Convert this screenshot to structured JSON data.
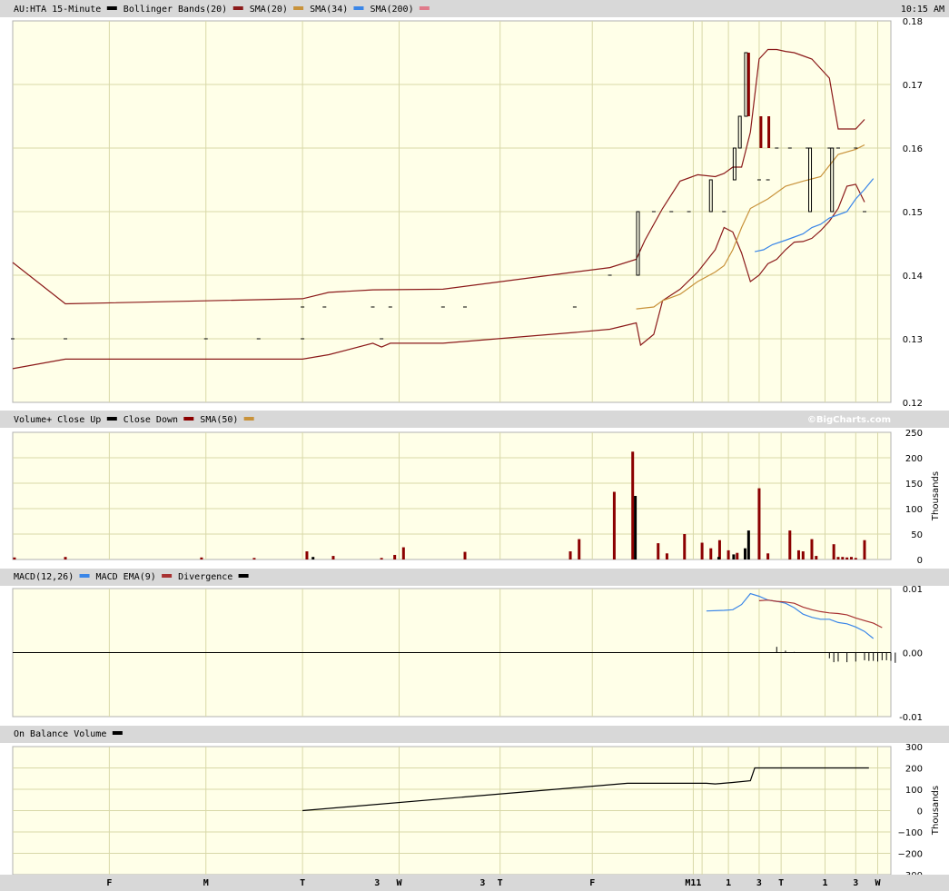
{
  "header": {
    "symbol": "AU:HTA 15-Minute",
    "time": "10:15 AM",
    "brand": "©BigCharts.com"
  },
  "colors": {
    "price": "#000000",
    "bb": "#8b1a1a",
    "sma20": "#c8923a",
    "sma34": "#3a86e8",
    "sma200": "#e07a8a",
    "volUp": "#000000",
    "volDown": "#8b0000",
    "macd": "#3a86e8",
    "macdEma": "#a83232",
    "obv": "#000000",
    "panelBg": "#ffffe8",
    "grid": "#d8d8a8",
    "band": "#d8d8d8"
  },
  "legends": {
    "price": [
      {
        "label": "Bollinger Bands(20)",
        "swatch": "bb"
      },
      {
        "label": "SMA(20)",
        "swatch": "sma20"
      },
      {
        "label": "SMA(34)",
        "swatch": "sma34"
      },
      {
        "label": "SMA(200)",
        "swatch": "sma200"
      }
    ],
    "volume": [
      {
        "label": "Volume+ Close Up",
        "swatch": "volUp"
      },
      {
        "label": "Close Down",
        "swatch": "volDown"
      },
      {
        "label": "SMA(50)",
        "swatch": "sma20"
      }
    ],
    "macd": [
      {
        "label": "MACD(12,26)",
        "swatch": "macd"
      },
      {
        "label": "MACD EMA(9)",
        "swatch": "macdEma"
      },
      {
        "label": "Divergence",
        "swatch": "volUp"
      }
    ],
    "obv": [
      {
        "label": "On Balance Volume",
        "swatch": "volUp"
      }
    ]
  },
  "chart_data": [
    {
      "type": "line",
      "panel": "price",
      "ylim": [
        0.12,
        0.18
      ],
      "yticks": [
        "0.18",
        "0.17",
        "0.16",
        "0.15",
        "0.14",
        "0.13",
        "0.12"
      ],
      "ytick_values": [
        0.18,
        0.17,
        0.16,
        0.15,
        0.14,
        0.13,
        0.12
      ],
      "xlim": [
        0,
        100
      ],
      "close_ticks": [
        [
          0,
          0.13
        ],
        [
          6,
          0.13
        ],
        [
          22,
          0.13
        ],
        [
          28,
          0.13
        ],
        [
          33,
          0.13
        ],
        [
          33,
          0.135
        ],
        [
          35.5,
          0.135
        ],
        [
          41,
          0.135
        ],
        [
          43,
          0.135
        ],
        [
          49,
          0.135
        ],
        [
          51.5,
          0.135
        ],
        [
          42,
          0.13
        ],
        [
          64,
          0.135
        ],
        [
          68,
          0.14
        ],
        [
          73,
          0.15
        ],
        [
          75,
          0.15
        ],
        [
          77,
          0.15
        ],
        [
          81,
          0.15
        ],
        [
          85,
          0.155
        ],
        [
          86,
          0.155
        ],
        [
          87,
          0.16
        ],
        [
          88.5,
          0.16
        ],
        [
          90.5,
          0.16
        ],
        [
          93,
          0.16
        ],
        [
          94,
          0.16
        ],
        [
          96,
          0.16
        ],
        [
          97,
          0.15
        ]
      ],
      "price_up_bars": [
        [
          71.2,
          0.14,
          0.15
        ],
        [
          79.5,
          0.15,
          0.155
        ],
        [
          82.2,
          0.155,
          0.16
        ],
        [
          82.8,
          0.16,
          0.165
        ],
        [
          83.5,
          0.165,
          0.175
        ],
        [
          90.8,
          0.15,
          0.16
        ],
        [
          93.3,
          0.15,
          0.16
        ]
      ],
      "price_down_bars": [
        [
          83.8,
          0.165,
          0.175
        ],
        [
          85.2,
          0.16,
          0.165
        ],
        [
          86.1,
          0.16,
          0.165
        ]
      ],
      "series": [
        {
          "key": "bbUpper",
          "color": "bb",
          "points": [
            [
              0,
              0.142
            ],
            [
              6,
              0.1355
            ],
            [
              33,
              0.1363
            ],
            [
              36,
              0.1373
            ],
            [
              41,
              0.1377
            ],
            [
              49,
              0.1378
            ],
            [
              64,
              0.1405
            ],
            [
              68,
              0.1412
            ],
            [
              71,
              0.1425
            ],
            [
              72,
              0.1455
            ],
            [
              74,
              0.1505
            ],
            [
              76,
              0.1548
            ],
            [
              78,
              0.1558
            ],
            [
              80,
              0.1555
            ],
            [
              81,
              0.156
            ],
            [
              82,
              0.157
            ],
            [
              83,
              0.157
            ],
            [
              84,
              0.1625
            ],
            [
              85,
              0.174
            ],
            [
              86,
              0.1755
            ],
            [
              87,
              0.1755
            ],
            [
              88,
              0.1752
            ],
            [
              89,
              0.175
            ],
            [
              90,
              0.1745
            ],
            [
              91,
              0.174
            ],
            [
              92,
              0.1725
            ],
            [
              93,
              0.171
            ],
            [
              93.5,
              0.167
            ],
            [
              94,
              0.163
            ],
            [
              96,
              0.163
            ],
            [
              97,
              0.1645
            ]
          ]
        },
        {
          "key": "bbLower",
          "color": "bb",
          "points": [
            [
              0,
              0.1253
            ],
            [
              6,
              0.1268
            ],
            [
              33,
              0.1268
            ],
            [
              36,
              0.1275
            ],
            [
              41,
              0.1293
            ],
            [
              42,
              0.1287
            ],
            [
              43,
              0.1293
            ],
            [
              49,
              0.1293
            ],
            [
              64,
              0.131
            ],
            [
              68,
              0.1315
            ],
            [
              71,
              0.1325
            ],
            [
              71.5,
              0.129
            ],
            [
              73,
              0.1307
            ],
            [
              74,
              0.136
            ],
            [
              76,
              0.1378
            ],
            [
              78,
              0.1405
            ],
            [
              80,
              0.144
            ],
            [
              81,
              0.1475
            ],
            [
              82,
              0.1468
            ],
            [
              83,
              0.1435
            ],
            [
              84,
              0.139
            ],
            [
              85,
              0.14
            ],
            [
              86,
              0.1418
            ],
            [
              87,
              0.1425
            ],
            [
              88,
              0.144
            ],
            [
              89,
              0.1452
            ],
            [
              90,
              0.1453
            ],
            [
              91,
              0.1458
            ],
            [
              92,
              0.147
            ],
            [
              93,
              0.1485
            ],
            [
              94,
              0.1505
            ],
            [
              95,
              0.154
            ],
            [
              96,
              0.1543
            ],
            [
              97,
              0.1515
            ]
          ]
        },
        {
          "key": "sma20",
          "color": "sma20",
          "points": [
            [
              71,
              0.1347
            ],
            [
              73,
              0.135
            ],
            [
              74,
              0.136
            ],
            [
              76,
              0.137
            ],
            [
              78,
              0.139
            ],
            [
              80,
              0.1405
            ],
            [
              81,
              0.1415
            ],
            [
              82,
              0.144
            ],
            [
              83,
              0.1475
            ],
            [
              84,
              0.1505
            ],
            [
              86,
              0.152
            ],
            [
              88,
              0.154
            ],
            [
              90,
              0.1548
            ],
            [
              92,
              0.1555
            ],
            [
              94,
              0.159
            ],
            [
              96,
              0.1598
            ],
            [
              97,
              0.1605
            ]
          ]
        },
        {
          "key": "sma34",
          "color": "sma34",
          "points": [
            [
              84.5,
              0.1437
            ],
            [
              85.5,
              0.144
            ],
            [
              86.5,
              0.1448
            ],
            [
              88,
              0.1455
            ],
            [
              89,
              0.146
            ],
            [
              90,
              0.1465
            ],
            [
              91,
              0.1475
            ],
            [
              92,
              0.148
            ],
            [
              93,
              0.149
            ],
            [
              94,
              0.1495
            ],
            [
              95,
              0.15
            ],
            [
              96,
              0.152
            ],
            [
              97,
              0.1535
            ],
            [
              98,
              0.1552
            ]
          ]
        }
      ]
    },
    {
      "type": "bar",
      "panel": "volume",
      "ylabel": "Thousands",
      "ylim": [
        0,
        250
      ],
      "yticks": [
        "250",
        "200",
        "150",
        "100",
        "50",
        "0"
      ],
      "ytick_values": [
        250,
        200,
        150,
        100,
        50,
        0
      ],
      "up_bars": [
        [
          34.2,
          5
        ],
        [
          70.9,
          125
        ],
        [
          80.4,
          5
        ],
        [
          82.1,
          10
        ],
        [
          83.4,
          22
        ],
        [
          83.8,
          57
        ]
      ],
      "down_bars": [
        [
          0.2,
          4
        ],
        [
          6,
          5
        ],
        [
          21.5,
          4
        ],
        [
          27.5,
          3
        ],
        [
          33.5,
          16
        ],
        [
          36.5,
          7
        ],
        [
          42,
          3
        ],
        [
          43.5,
          9
        ],
        [
          44.5,
          24
        ],
        [
          51.5,
          15
        ],
        [
          63.5,
          16
        ],
        [
          64.5,
          40
        ],
        [
          68.5,
          133
        ],
        [
          70.6,
          212
        ],
        [
          73.5,
          32
        ],
        [
          74.5,
          12
        ],
        [
          76.5,
          50
        ],
        [
          78.5,
          33
        ],
        [
          79.5,
          22
        ],
        [
          80.5,
          38
        ],
        [
          81.5,
          18
        ],
        [
          82.5,
          13
        ],
        [
          85,
          140
        ],
        [
          86,
          12
        ],
        [
          88.5,
          57
        ],
        [
          89.5,
          18
        ],
        [
          90,
          16
        ],
        [
          91,
          40
        ],
        [
          91.5,
          7
        ],
        [
          93.5,
          30
        ],
        [
          94,
          5
        ],
        [
          94.5,
          5
        ],
        [
          95,
          4
        ],
        [
          95.5,
          5
        ],
        [
          96,
          3
        ],
        [
          97,
          38
        ]
      ]
    },
    {
      "type": "line",
      "panel": "macd",
      "ylim": [
        -0.01,
        0.01
      ],
      "yticks": [
        "0.01",
        "0.00",
        "-0.01"
      ],
      "ytick_values": [
        0.01,
        0.0,
        -0.01
      ],
      "series": [
        {
          "key": "macd",
          "color": "macd",
          "points": [
            [
              79,
              0.0065
            ],
            [
              81,
              0.0066
            ],
            [
              82,
              0.0067
            ],
            [
              83,
              0.0075
            ],
            [
              84,
              0.0092
            ],
            [
              85,
              0.0088
            ],
            [
              86,
              0.0082
            ],
            [
              87,
              0.008
            ],
            [
              88,
              0.0077
            ],
            [
              89,
              0.007
            ],
            [
              90,
              0.006
            ],
            [
              91,
              0.0055
            ],
            [
              92,
              0.0052
            ],
            [
              93,
              0.0052
            ],
            [
              94,
              0.0047
            ],
            [
              95,
              0.0045
            ],
            [
              96,
              0.004
            ],
            [
              97,
              0.0033
            ],
            [
              98,
              0.0022
            ]
          ]
        },
        {
          "key": "macdEma",
          "color": "macdEma",
          "points": [
            [
              85,
              0.0081
            ],
            [
              86,
              0.0082
            ],
            [
              87,
              0.008
            ],
            [
              88,
              0.0079
            ],
            [
              89,
              0.0077
            ],
            [
              90,
              0.0071
            ],
            [
              91,
              0.0067
            ],
            [
              92,
              0.0064
            ],
            [
              93,
              0.0062
            ],
            [
              94,
              0.0061
            ],
            [
              95,
              0.0059
            ],
            [
              96,
              0.0054
            ],
            [
              97,
              0.005
            ],
            [
              98,
              0.0046
            ],
            [
              99,
              0.0039
            ]
          ]
        }
      ],
      "divergence": [
        [
          87,
          0.0009
        ],
        [
          88,
          0.0003
        ],
        [
          89,
          0.0001
        ],
        [
          93,
          -0.0009
        ],
        [
          93.5,
          -0.0015
        ],
        [
          94,
          -0.0014
        ],
        [
          95,
          -0.0015
        ],
        [
          96,
          -0.0014
        ],
        [
          97,
          -0.0012
        ],
        [
          97.5,
          -0.0013
        ],
        [
          98,
          -0.0013
        ],
        [
          98.5,
          -0.0014
        ],
        [
          99,
          -0.0012
        ],
        [
          99.5,
          -0.0012
        ],
        [
          100,
          -0.0013
        ],
        [
          100.5,
          -0.0016
        ]
      ]
    },
    {
      "type": "line",
      "panel": "obv",
      "ylabel": "Thousands",
      "ylim": [
        -300,
        300
      ],
      "yticks": [
        "300",
        "200",
        "100",
        "0",
        "−100",
        "−200",
        "−300"
      ],
      "ytick_values": [
        300,
        200,
        100,
        0,
        -100,
        -200,
        -300
      ],
      "series": [
        {
          "key": "obv",
          "color": "obv",
          "points": [
            [
              33,
              0
            ],
            [
              70,
              128
            ],
            [
              79,
              128
            ],
            [
              80,
              125
            ],
            [
              82,
              132
            ],
            [
              84,
              140
            ],
            [
              84.5,
              200
            ],
            [
              97.5,
              200
            ]
          ]
        }
      ]
    }
  ],
  "xaxis": {
    "ticks": [
      {
        "label": "F",
        "x": 11
      },
      {
        "label": "M",
        "x": 22
      },
      {
        "label": "T",
        "x": 33
      },
      {
        "label": "3",
        "x": 41.5
      },
      {
        "label": "W",
        "x": 44
      },
      {
        "label": "3",
        "x": 53.5
      },
      {
        "label": "T",
        "x": 55.5
      },
      {
        "label": "F",
        "x": 66
      },
      {
        "label": "M11",
        "x": 77.5
      },
      {
        "label": "1",
        "x": 81.5
      },
      {
        "label": "3",
        "x": 85
      },
      {
        "label": "T",
        "x": 87.5
      },
      {
        "label": "1",
        "x": 92.5
      },
      {
        "label": "3",
        "x": 96
      },
      {
        "label": "W",
        "x": 98.5
      }
    ],
    "gridlines": [
      11,
      22,
      33,
      44,
      55.5,
      66,
      77.5,
      78.5,
      81.5,
      85,
      87.5,
      92.5,
      96,
      98.5
    ]
  }
}
